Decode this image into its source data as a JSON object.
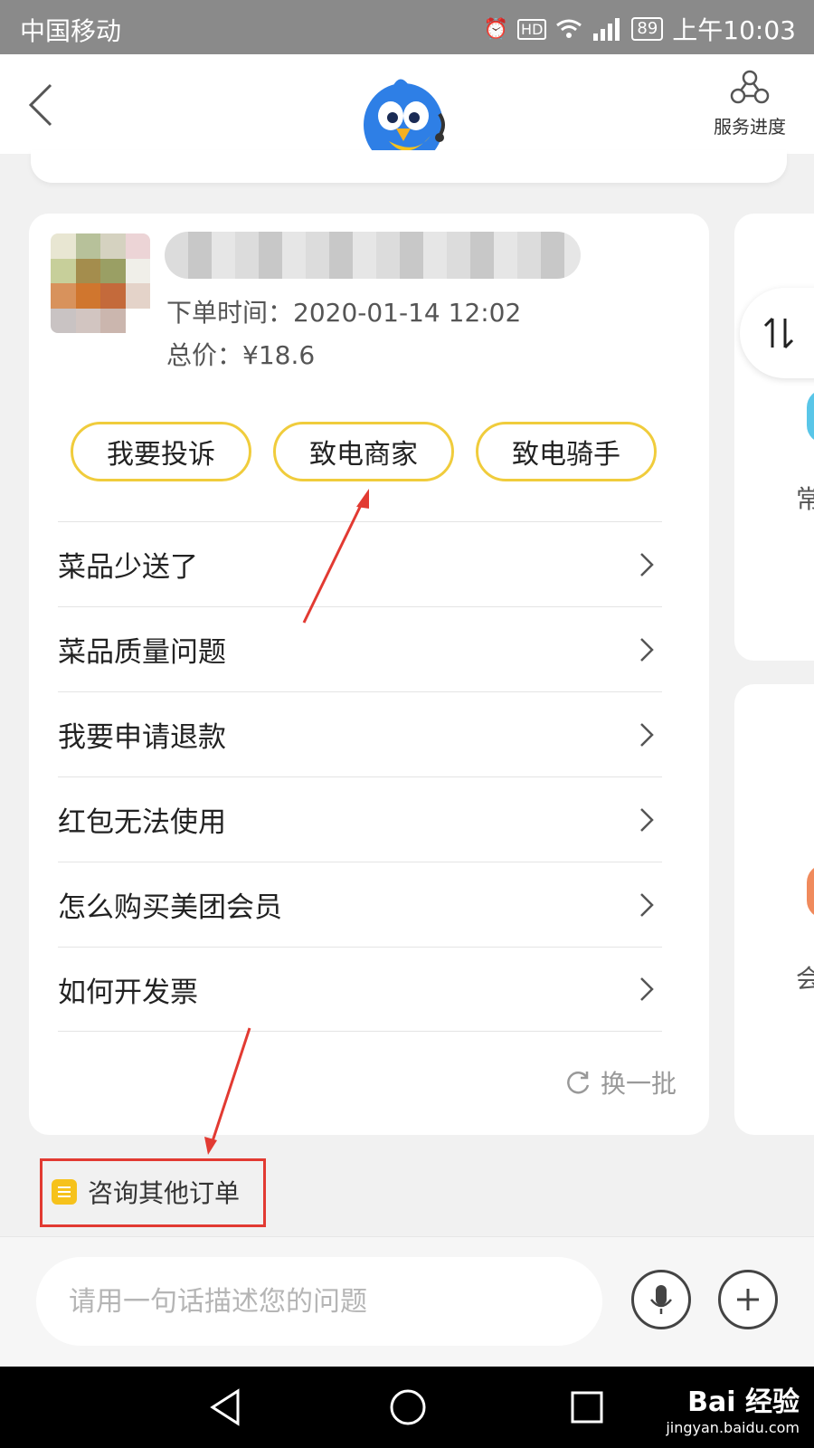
{
  "status_bar": {
    "carrier": "中国移动",
    "battery": "89",
    "time": "上午10:03",
    "icons": [
      "alarm-icon",
      "hd-icon",
      "wifi-icon",
      "4g-signal-icon"
    ]
  },
  "header": {
    "back_icon": "chevron-left-icon",
    "mascot_icon": "bird-mascot-icon",
    "progress_label": "服务进度"
  },
  "order_card": {
    "order_time": "下单时间：2020-01-14 12:02",
    "total_price": "总价：¥18.6",
    "actions": {
      "complain": "我要投诉",
      "call_merchant": "致电商家",
      "call_rider": "致电骑手"
    },
    "faq": [
      {
        "label": "菜品少送了"
      },
      {
        "label": "菜品质量问题"
      },
      {
        "label": "我要申请退款"
      },
      {
        "label": "红包无法使用"
      },
      {
        "label": "怎么购买美团会员"
      },
      {
        "label": "如何开发票"
      }
    ],
    "refresh_label": "换一批"
  },
  "side_cards": {
    "sort_icon": "sort-arrows-icon",
    "partial_char_1": "常",
    "partial_char_2": "会"
  },
  "consult": {
    "label": "咨询其他订单"
  },
  "input_bar": {
    "placeholder": "请用一句话描述您的问题"
  },
  "watermark": {
    "main": "Bai 经验",
    "sub": "jingyan.baidu.com"
  },
  "colors": {
    "accent_yellow": "#f0cc3c",
    "highlight_red": "#e23a32",
    "mascot_blue": "#2e7fe6"
  }
}
